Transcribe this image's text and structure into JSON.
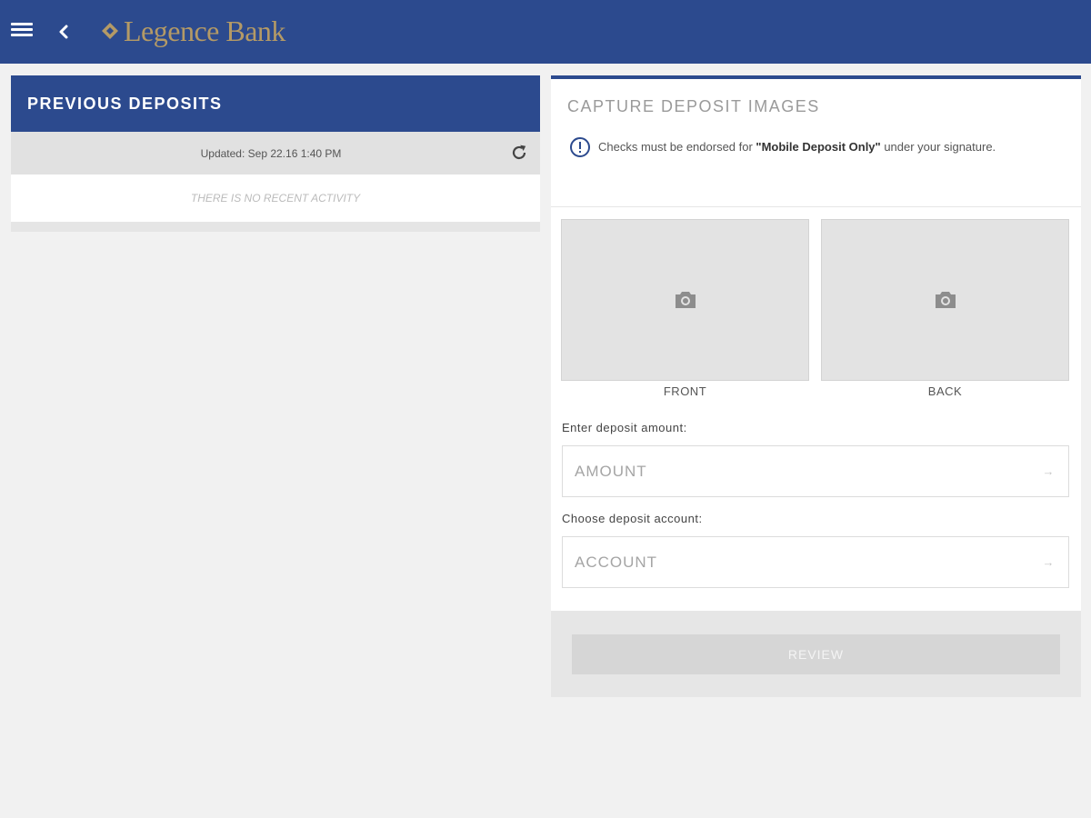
{
  "header": {
    "brand_name": "Legence Bank",
    "brand_color": "#2c4a8e",
    "logo_color": "#b49a66",
    "icons": [
      "hamburger-menu-icon",
      "back-arrow-icon",
      "diamond-logo-icon"
    ]
  },
  "previous_deposits": {
    "title": "PREVIOUS DEPOSITS",
    "updated_text": "Updated: Sep 22.16 1:40 PM",
    "empty_text": "THERE IS NO RECENT ACTIVITY",
    "refresh_icon": "refresh-icon"
  },
  "capture": {
    "title": "CAPTURE DEPOSIT IMAGES",
    "notice_prefix": "Checks must be endorsed for ",
    "notice_bold": "\"Mobile Deposit Only\"",
    "notice_suffix": " under your signature.",
    "notice_icon": "info-icon",
    "front_label": "FRONT",
    "back_label": "BACK",
    "camera_icon": "camera-icon",
    "amount_label": "Enter deposit amount:",
    "amount_placeholder": "AMOUNT",
    "account_label": "Choose deposit account:",
    "account_placeholder": "ACCOUNT",
    "field_arrow": "→",
    "review_label": "REVIEW"
  }
}
